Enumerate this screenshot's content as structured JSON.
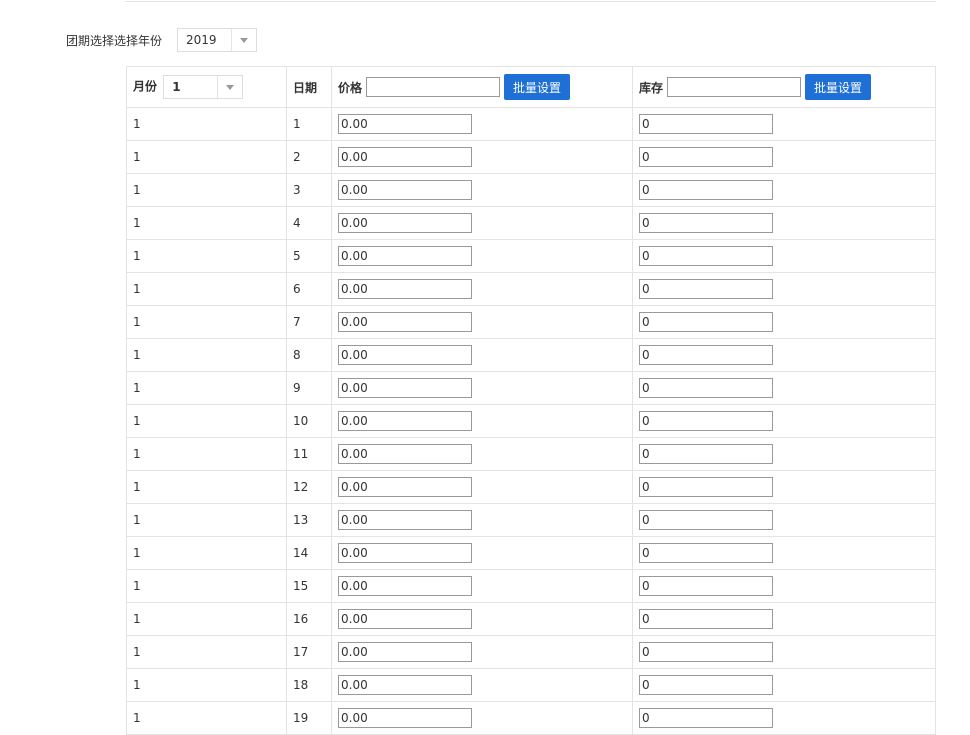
{
  "filter": {
    "year_label": "团期选择选择年份",
    "year_value": "2019"
  },
  "table": {
    "month_header": "月份",
    "month_value": "1",
    "day_header": "日期",
    "price_header": "价格",
    "stock_header": "库存",
    "batch_button_label": "批量设置",
    "price_batch_value": "",
    "stock_batch_value": "",
    "rows": [
      {
        "month": "1",
        "day": "1",
        "price": "0.00",
        "stock": "0"
      },
      {
        "month": "1",
        "day": "2",
        "price": "0.00",
        "stock": "0"
      },
      {
        "month": "1",
        "day": "3",
        "price": "0.00",
        "stock": "0"
      },
      {
        "month": "1",
        "day": "4",
        "price": "0.00",
        "stock": "0"
      },
      {
        "month": "1",
        "day": "5",
        "price": "0.00",
        "stock": "0"
      },
      {
        "month": "1",
        "day": "6",
        "price": "0.00",
        "stock": "0"
      },
      {
        "month": "1",
        "day": "7",
        "price": "0.00",
        "stock": "0"
      },
      {
        "month": "1",
        "day": "8",
        "price": "0.00",
        "stock": "0"
      },
      {
        "month": "1",
        "day": "9",
        "price": "0.00",
        "stock": "0"
      },
      {
        "month": "1",
        "day": "10",
        "price": "0.00",
        "stock": "0"
      },
      {
        "month": "1",
        "day": "11",
        "price": "0.00",
        "stock": "0"
      },
      {
        "month": "1",
        "day": "12",
        "price": "0.00",
        "stock": "0"
      },
      {
        "month": "1",
        "day": "13",
        "price": "0.00",
        "stock": "0"
      },
      {
        "month": "1",
        "day": "14",
        "price": "0.00",
        "stock": "0"
      },
      {
        "month": "1",
        "day": "15",
        "price": "0.00",
        "stock": "0"
      },
      {
        "month": "1",
        "day": "16",
        "price": "0.00",
        "stock": "0"
      },
      {
        "month": "1",
        "day": "17",
        "price": "0.00",
        "stock": "0"
      },
      {
        "month": "1",
        "day": "18",
        "price": "0.00",
        "stock": "0"
      },
      {
        "month": "1",
        "day": "19",
        "price": "0.00",
        "stock": "0"
      }
    ]
  }
}
